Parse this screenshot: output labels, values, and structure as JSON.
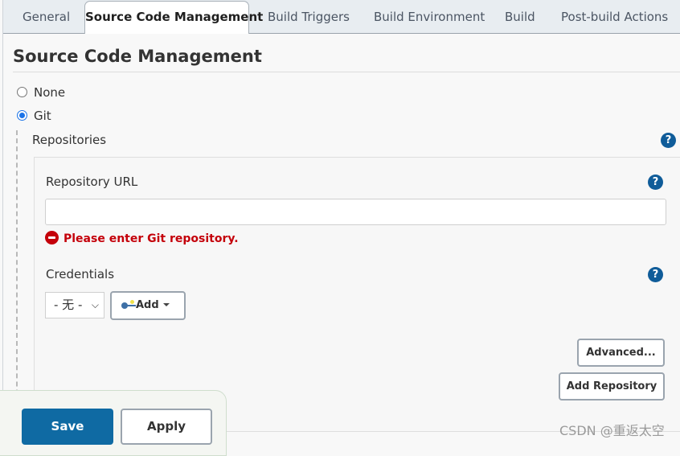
{
  "tabs": [
    {
      "label": "General",
      "active": false
    },
    {
      "label": "Source Code Management",
      "active": true
    },
    {
      "label": "Build Triggers",
      "active": false
    },
    {
      "label": "Build Environment",
      "active": false
    },
    {
      "label": "Build",
      "active": false
    },
    {
      "label": "Post-build Actions",
      "active": false
    }
  ],
  "section": {
    "title": "Source Code Management",
    "options": [
      {
        "label": "None",
        "selected": false
      },
      {
        "label": "Git",
        "selected": true
      }
    ]
  },
  "repositories": {
    "label": "Repositories",
    "help_icon": "question-circle-icon",
    "repository_url": {
      "label": "Repository URL",
      "value": "",
      "error": "Please enter Git repository."
    },
    "credentials": {
      "label": "Credentials",
      "selected": "- 无 -",
      "add_label": "Add"
    },
    "advanced_label": "Advanced...",
    "add_repository_label": "Add Repository"
  },
  "footer": {
    "save_label": "Save",
    "apply_label": "Apply"
  },
  "help_glyph": "?",
  "watermark": "CSDN @重返太空",
  "colors": {
    "primary": "#0f6aa3",
    "error": "#c4000a",
    "help": "#0f5c99",
    "radio_checked": "#1a73e8"
  }
}
